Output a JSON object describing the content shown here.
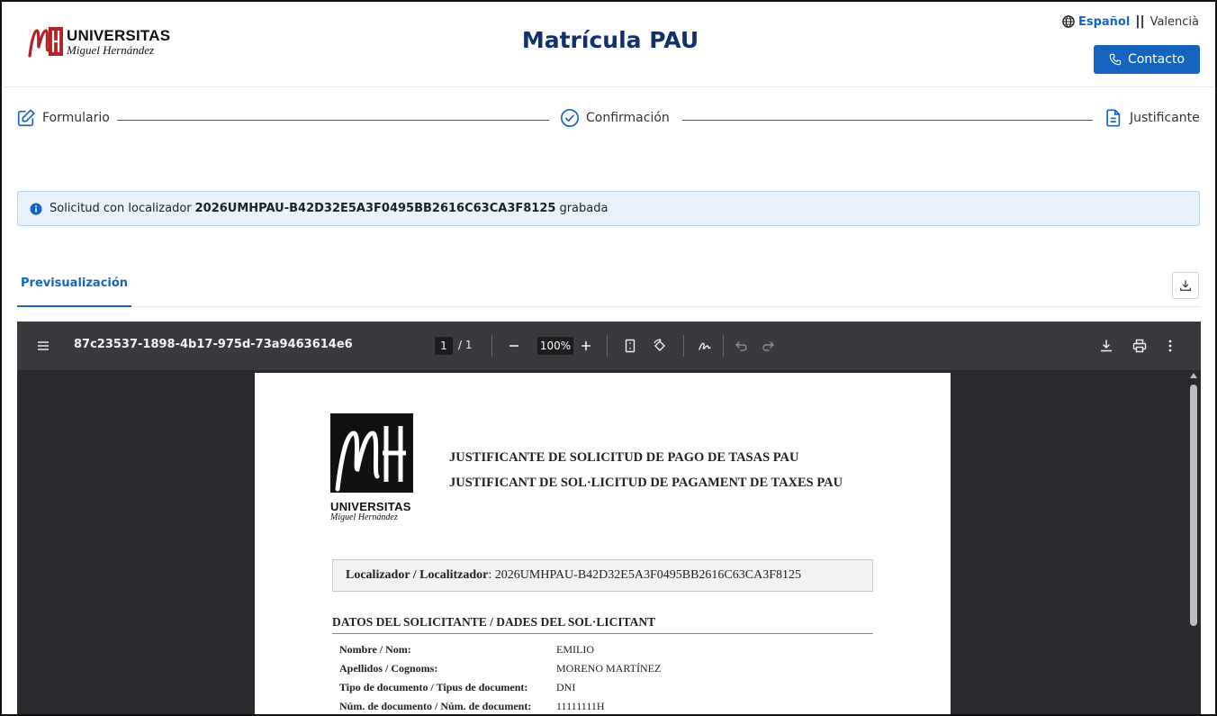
{
  "header": {
    "logo_line1": "UNIVERSITAS",
    "logo_line2": "Miguel Hernández",
    "title": "Matrícula PAU",
    "lang_active": "Español",
    "lang_sep": "||",
    "lang_other": "Valencià",
    "contact_label": "Contacto"
  },
  "stepper": {
    "steps": [
      {
        "label": "Formulario",
        "icon": "edit-icon"
      },
      {
        "label": "Confirmación",
        "icon": "check-circle-icon"
      },
      {
        "label": "Justificante",
        "icon": "document-icon"
      }
    ]
  },
  "alert": {
    "prefix": "Solicitud con localizador",
    "locator": "2026UMHPAU-B42D32E5A3F0495BB2616C63CA3F8125",
    "suffix": "grabada"
  },
  "tabs": {
    "active": "Previsualización"
  },
  "viewer": {
    "filename": "87c23537-1898-4b17-975d-73a9463614e6",
    "page_current": "1",
    "page_total": "/ 1",
    "zoom": "100%"
  },
  "pdf": {
    "logo_line1": "UNIVERSITAS",
    "logo_line2": "Miguel Hernández",
    "heading_es": "JUSTIFICANTE DE SOLICITUD DE PAGO DE TASAS PAU",
    "heading_va": "JUSTIFICANT DE SOL·LICITUD DE PAGAMENT DE TAXES PAU",
    "locator_label": "Localizador / Localitzador",
    "locator_value": ": 2026UMHPAU-B42D32E5A3F0495BB2616C63CA3F8125",
    "section_title": "DATOS DEL SOLICITANTE / DADES DEL SOL·LICITANT",
    "fields": [
      {
        "label": "Nombre / Nom:",
        "value": "EMILIO"
      },
      {
        "label": "Apellidos / Cognoms:",
        "value": "MORENO MARTÍNEZ"
      },
      {
        "label": "Tipo de documento / Tipus de document:",
        "value": "DNI"
      },
      {
        "label": "Núm. de documento / Núm. de document:",
        "value": "11111111H"
      }
    ]
  },
  "colors": {
    "primary": "#1565c0",
    "title": "#12306b",
    "alert_bg": "#e8f2fc",
    "viewer_toolbar": "#3a3a3e",
    "viewer_bg": "#2a2a2e"
  }
}
